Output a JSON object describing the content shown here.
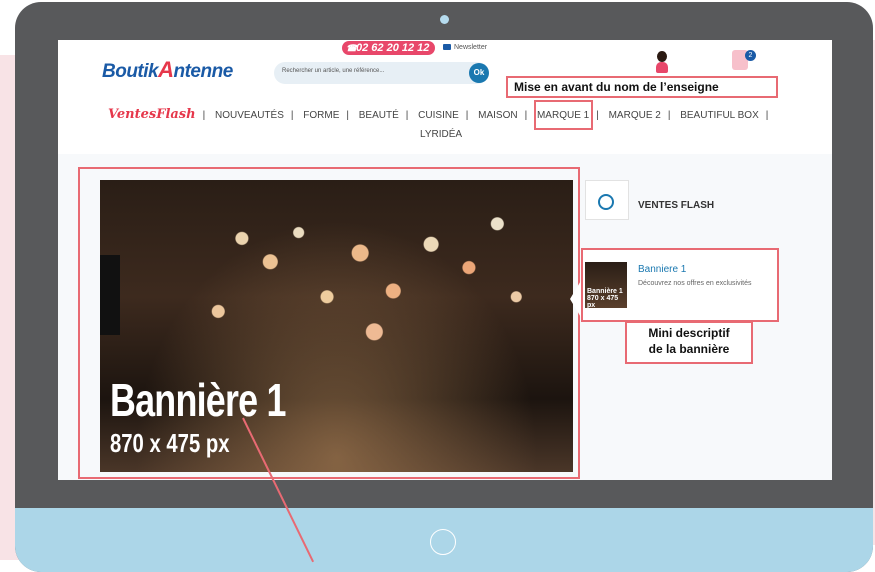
{
  "header": {
    "logo_part1": "Boutik",
    "logo_part2": "A",
    "logo_part3": "ntenne",
    "phone": "02 62 20 12 12",
    "newsletter": "Newsletter",
    "search_placeholder": "Rechercher un article, une référence...",
    "search_button": "Ok",
    "cart_count": "2"
  },
  "annotations": {
    "store_name": "Mise en avant du nom de l’enseigne",
    "banner_desc_line1": "Mini descriptif",
    "banner_desc_line2": "de la bannière"
  },
  "nav": {
    "flash": "VentesFlash",
    "items": [
      "NOUVEAUTÉS",
      "FORME",
      "BEAUTÉ",
      "CUISINE",
      "MAISON",
      "MARQUE 1",
      "MARQUE 2",
      "BEAUTIFUL BOX"
    ],
    "second_row": "LYRIDÉA"
  },
  "banner": {
    "title": "Bannière 1",
    "size": "870 x 475 px"
  },
  "sidebar": {
    "flash_label": "VENTES FLASH",
    "banner_title": "Banniere 1",
    "banner_desc": "Découvrez nos offres en exclusivités",
    "thumb_text": "Bannière 1 870 x 475 px"
  },
  "colors": {
    "frame": "#58595b",
    "chin": "#acd6e8",
    "accent": "#e86a73",
    "brand_blue": "#1a5aa6"
  }
}
